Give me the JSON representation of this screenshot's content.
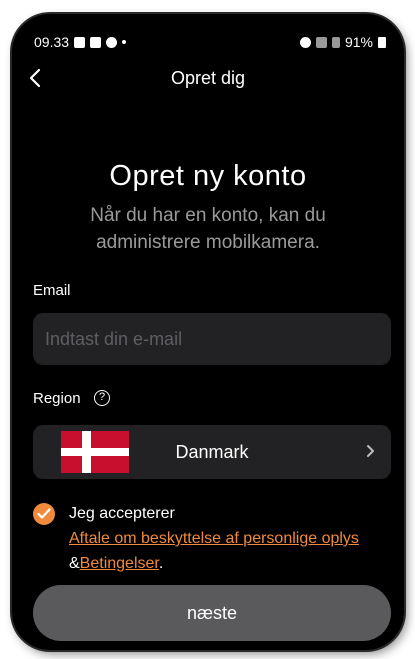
{
  "status_bar": {
    "time": "09.33",
    "battery": "91%"
  },
  "nav": {
    "back_icon": "chevron-left-icon",
    "title": "Opret dig"
  },
  "main": {
    "heading": "Opret ny konto",
    "subtitle": "Når du har en konto, kan du administrere mobilkamera."
  },
  "email": {
    "label": "Email",
    "value": "",
    "placeholder": "Indtast din e-mail"
  },
  "region": {
    "label": "Region",
    "help_icon": "question-circle-icon",
    "selected": "Danmark",
    "flag": "denmark-flag",
    "chevron_icon": "chevron-right-icon"
  },
  "agreement": {
    "checked": true,
    "accept_text": "Jeg accepterer",
    "privacy_link": "Aftale om beskyttelse af personlige oplys",
    "ampersand": "&",
    "terms_link": "Betingelser",
    "period": "."
  },
  "footer": {
    "next_label": "næste"
  },
  "colors": {
    "accent": "#f08a3c",
    "background": "#000000",
    "field": "#222224",
    "button": "#5a5a5c"
  }
}
